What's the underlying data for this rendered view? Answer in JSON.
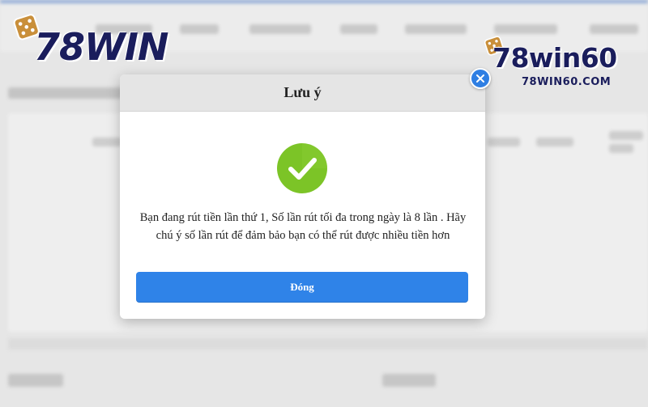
{
  "modal": {
    "title": "Lưu ý",
    "message": "Bạn đang rút tiền lần thứ 1, Số lần rút tối đa trong ngày là 8 lần . Hãy chú ý số lần rút để đảm bảo bạn có thể rút được nhiều tiền hơn",
    "confirm_label": "Đóng",
    "status_icon": "check-icon",
    "close_icon": "close-icon"
  },
  "logos": {
    "left_brand": "78WIN",
    "right_brand": "78win60",
    "right_domain": "78WIN60.COM"
  },
  "colors": {
    "accent": "#2f83e8",
    "success": "#7cc427",
    "brand": "#1a1d5c"
  }
}
